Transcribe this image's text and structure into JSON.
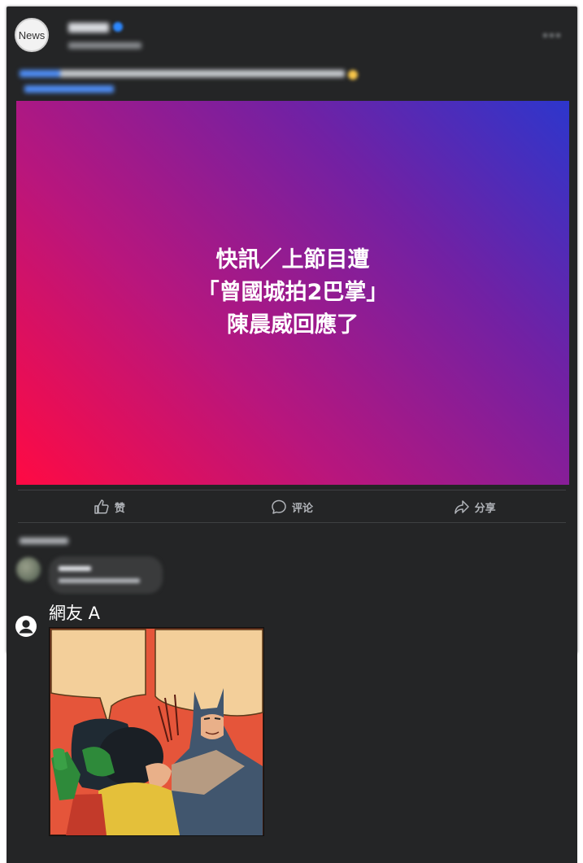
{
  "post": {
    "avatar_text": "News",
    "headline_lines": [
      "快訊／上節目遭",
      "「曾國城拍2巴掌」",
      "陳晨威回應了"
    ],
    "banner_colors": [
      "#ff0a43",
      "#b8167d",
      "#7121a4",
      "#2d36cc"
    ]
  },
  "actions": {
    "like_label": "赞",
    "comment_label": "评论",
    "share_label": "分享"
  },
  "netizen": {
    "name": "網友 A",
    "icon": "person-circle-icon"
  },
  "colors": {
    "card_bg": "#242526",
    "text_muted": "#b0b3b8",
    "accent_blue": "#2d88ff"
  }
}
